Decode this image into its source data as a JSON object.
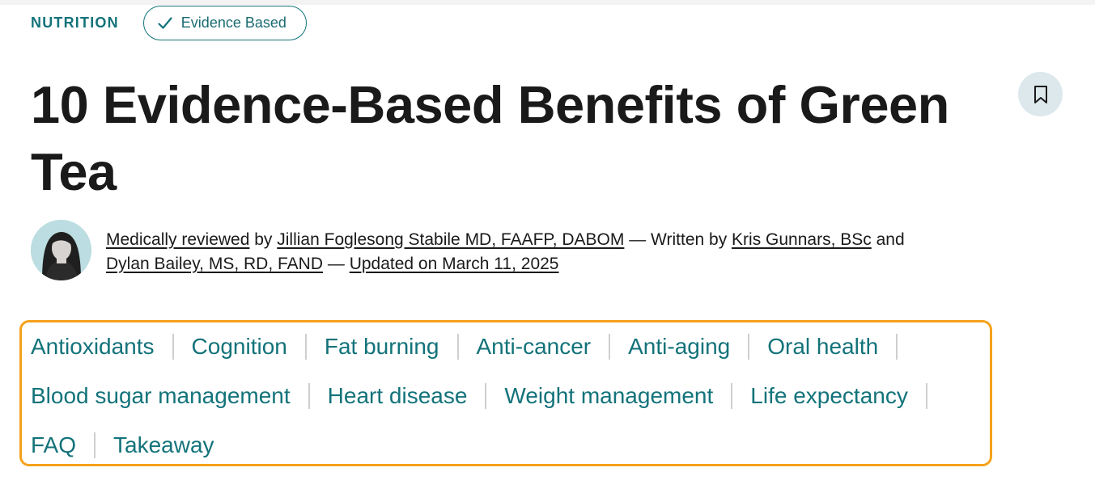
{
  "header": {
    "category": "NUTRITION",
    "badge_label": "Evidence Based"
  },
  "article": {
    "title": "10 Evidence-Based Benefits of Green Tea"
  },
  "byline": {
    "medically_reviewed": "Medically reviewed",
    "by_1": " by ",
    "reviewer": "Jillian Foglesong Stabile MD, FAAFP, DABOM",
    "written_by": " — Written by ",
    "author_1": "Kris Gunnars, BSc",
    "and": " and ",
    "author_2": "Dylan Bailey, MS, RD, FAND",
    "dash": " — ",
    "updated": "Updated on March 11, 2025"
  },
  "toc": {
    "row1": [
      "Antioxidants",
      "Cognition",
      "Fat burning",
      "Anti-cancer",
      "Anti-aging",
      "Oral health"
    ],
    "row2": [
      "Blood sugar management",
      "Heart disease",
      "Weight management",
      "Life expectancy"
    ],
    "row3": [
      "FAQ",
      "Takeaway"
    ]
  },
  "icons": {
    "badge": "check-icon",
    "bookmark": "bookmark-icon"
  },
  "colors": {
    "accent": "#13737a",
    "toc_border": "#f5a21c",
    "bookmark_bg": "#dce8eb",
    "text": "#1a1a1a"
  }
}
